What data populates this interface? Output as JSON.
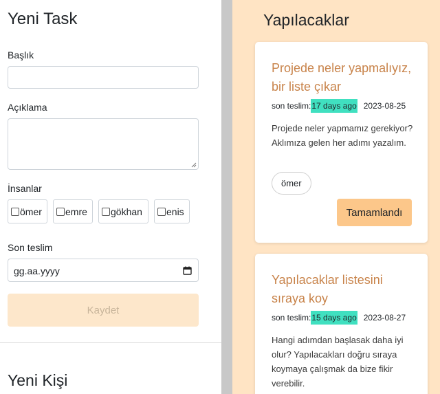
{
  "form": {
    "title": "Yeni Task",
    "title_label": "Başlık",
    "title_value": "",
    "description_label": "Açıklama",
    "description_value": "",
    "people_label": "İnsanlar",
    "people": [
      {
        "name": "ömer",
        "checked": false
      },
      {
        "name": "emre",
        "checked": false
      },
      {
        "name": "gökhan",
        "checked": false
      },
      {
        "name": "enis",
        "checked": false
      }
    ],
    "due_label": "Son teslim",
    "due_placeholder": "gg.aa.yyyy",
    "save_label": "Kaydet"
  },
  "person_section": {
    "title": "Yeni Kişi"
  },
  "todo": {
    "title": "Yapılacaklar",
    "cards": [
      {
        "title_line1": "Projede neler yapmalıyız,",
        "title_line2": "bir liste çıkar",
        "due_prefix": "son teslim:",
        "ago": "17 days ago",
        "due_date": "2023-08-25",
        "description": "Projede neler yapmamız gerekiyor? Aklımıza gelen her adımı yazalım.",
        "assignee": "ömer",
        "done_label": "Tamamlandı"
      },
      {
        "title_line1": "Yapılacaklar listesini",
        "title_line2": "sıraya koy",
        "due_prefix": "son teslim:",
        "ago": "15 days ago",
        "due_date": "2023-08-27",
        "description": "Hangi adımdan başlasak daha iyi olur? Yapılacakları doğru sıraya koymaya çalışmak da bize fikir verebilir."
      }
    ]
  },
  "colors": {
    "panel_bg": "#ffe4c4",
    "accent_text": "#c8834a",
    "ago_badge": "#40e0c0",
    "done_button": "#fcc78a",
    "save_disabled": "#fde7cb"
  }
}
